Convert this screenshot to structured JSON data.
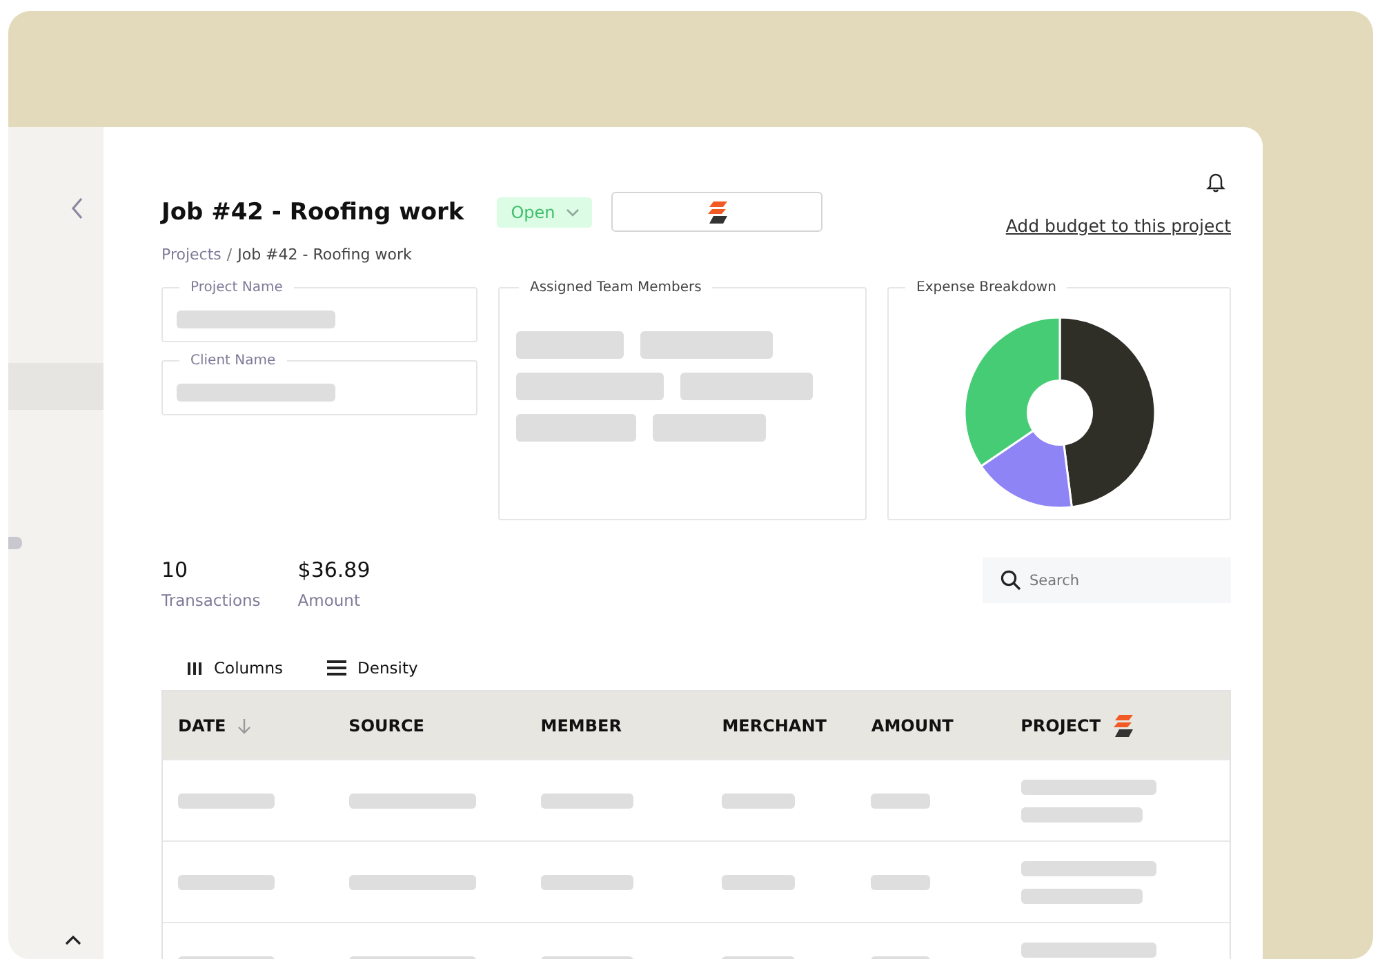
{
  "title": "Job #42 - Roofing work",
  "status": {
    "label": "Open"
  },
  "breadcrumb": [
    "Projects",
    "Job #42 - Roofing work"
  ],
  "breadcrumb_separator": "/",
  "budget_link": "Add budget to this project",
  "fields": [
    {
      "label": "Project Name"
    },
    {
      "label": "Client Name"
    }
  ],
  "team_panel": {
    "title": "Assigned Team Members"
  },
  "expense_panel": {
    "title": "Expense Breakdown"
  },
  "stats": [
    {
      "value": "10",
      "label": "Transactions"
    },
    {
      "value": "$36.89",
      "label": "Amount"
    }
  ],
  "search": {
    "placeholder": "Search"
  },
  "toolbar": [
    "Columns",
    "Density"
  ],
  "columns": [
    {
      "label": "DATE",
      "sorted": true
    },
    {
      "label": "SOURCE",
      "sorted": false
    },
    {
      "label": "MEMBER",
      "sorted": false
    },
    {
      "label": "MERCHANT",
      "sorted": false
    },
    {
      "label": "AMOUNT",
      "sorted": false
    },
    {
      "label": "PROJECT",
      "sorted": false
    }
  ]
}
